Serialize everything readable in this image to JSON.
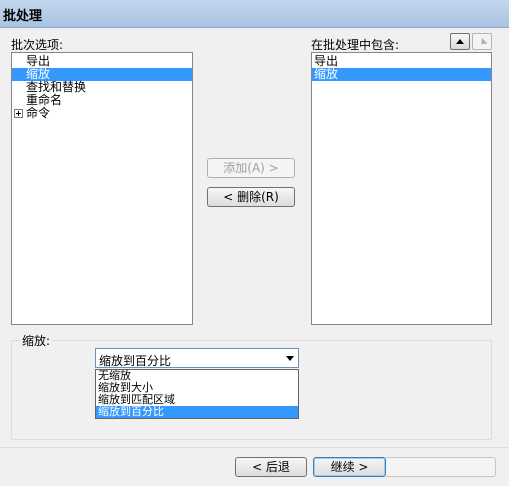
{
  "window": {
    "title": "批处理"
  },
  "left_panel": {
    "label": "批次选项:",
    "items": [
      {
        "label": "导出",
        "selected": false,
        "expandable": false
      },
      {
        "label": "缩放",
        "selected": true,
        "expandable": false
      },
      {
        "label": "查找和替换",
        "selected": false,
        "expandable": false
      },
      {
        "label": "重命名",
        "selected": false,
        "expandable": false
      },
      {
        "label": "命令",
        "selected": false,
        "expandable": true
      }
    ]
  },
  "middle_buttons": {
    "add": "添加(A) >",
    "remove": "< 删除(R)"
  },
  "right_panel": {
    "label": "在批处理中包含:",
    "items": [
      {
        "label": "导出",
        "selected": false
      },
      {
        "label": "缩放",
        "selected": true
      }
    ]
  },
  "scale_group": {
    "label": "缩放:",
    "selected_value": "缩放到百分比",
    "options": [
      "无缩放",
      "缩放到大小",
      "缩放到匹配区域",
      "缩放到百分比"
    ],
    "selected_option_index": 3
  },
  "footer": {
    "back": "< 后退",
    "continue": "继续 >"
  },
  "colors": {
    "selection": "#3399ff",
    "titlebar": "#b7cde6"
  }
}
